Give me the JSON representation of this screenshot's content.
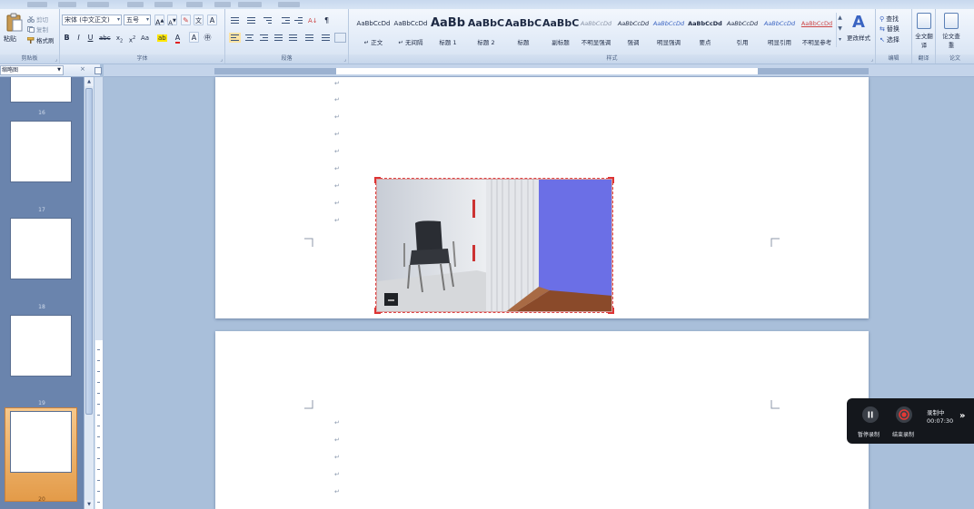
{
  "ribbon": {
    "clipboard": {
      "paste": "粘贴",
      "cut": "剪切",
      "copy": "复制",
      "format_painter": "格式刷",
      "group": "剪贴板"
    },
    "font": {
      "family": "宋体 (中文正文)",
      "size": "五号",
      "group": "字体"
    },
    "paragraph": {
      "group": "段落"
    },
    "styles": {
      "group": "样式",
      "change_styles": "更改样式",
      "items": [
        {
          "sample": "AaBbCcDd",
          "name": "↵ 正文"
        },
        {
          "sample": "AaBbCcDd",
          "name": "↵ 无间隔"
        },
        {
          "sample": "AaBb",
          "name": "标题 1"
        },
        {
          "sample": "AaBbC",
          "name": "标题 2"
        },
        {
          "sample": "AaBbC",
          "name": "标题"
        },
        {
          "sample": "AaBbC",
          "name": "副标题"
        },
        {
          "sample": "AaBbCcDd",
          "name": "不明显强调"
        },
        {
          "sample": "AaBbCcDd",
          "name": "强调"
        },
        {
          "sample": "AaBbCcDd",
          "name": "明显强调"
        },
        {
          "sample": "AaBbCcDd",
          "name": "要点"
        },
        {
          "sample": "AaBbCcDd",
          "name": "引用"
        },
        {
          "sample": "AaBbCcDd",
          "name": "明显引用"
        },
        {
          "sample": "AaBbCcDd",
          "name": "不明显参考"
        }
      ]
    },
    "editing": {
      "group": "编辑",
      "find": "查找",
      "replace": "替换",
      "select": "选择"
    },
    "translate": {
      "label": "全文翻译",
      "group": "翻译"
    },
    "paper": {
      "label": "论文查重",
      "group": "论文"
    }
  },
  "nav": {
    "view": "缩略图",
    "close": "×",
    "thumbnails": [
      {
        "number": "16"
      },
      {
        "number": "17"
      },
      {
        "number": "18"
      },
      {
        "number": "19"
      },
      {
        "number": "20"
      }
    ]
  },
  "document": {
    "paragraph_mark": "↵"
  },
  "recorder": {
    "pause_label": "暂停录制",
    "stop_label": "结束录制",
    "status": "录制中",
    "elapsed": "00:07:30",
    "collapse": "»"
  },
  "colors": {
    "accent_blue": "#3a64c2",
    "selection_orange": "#e39b49",
    "record_red": "#e53935",
    "wall_blue": "#6b6fe6"
  }
}
